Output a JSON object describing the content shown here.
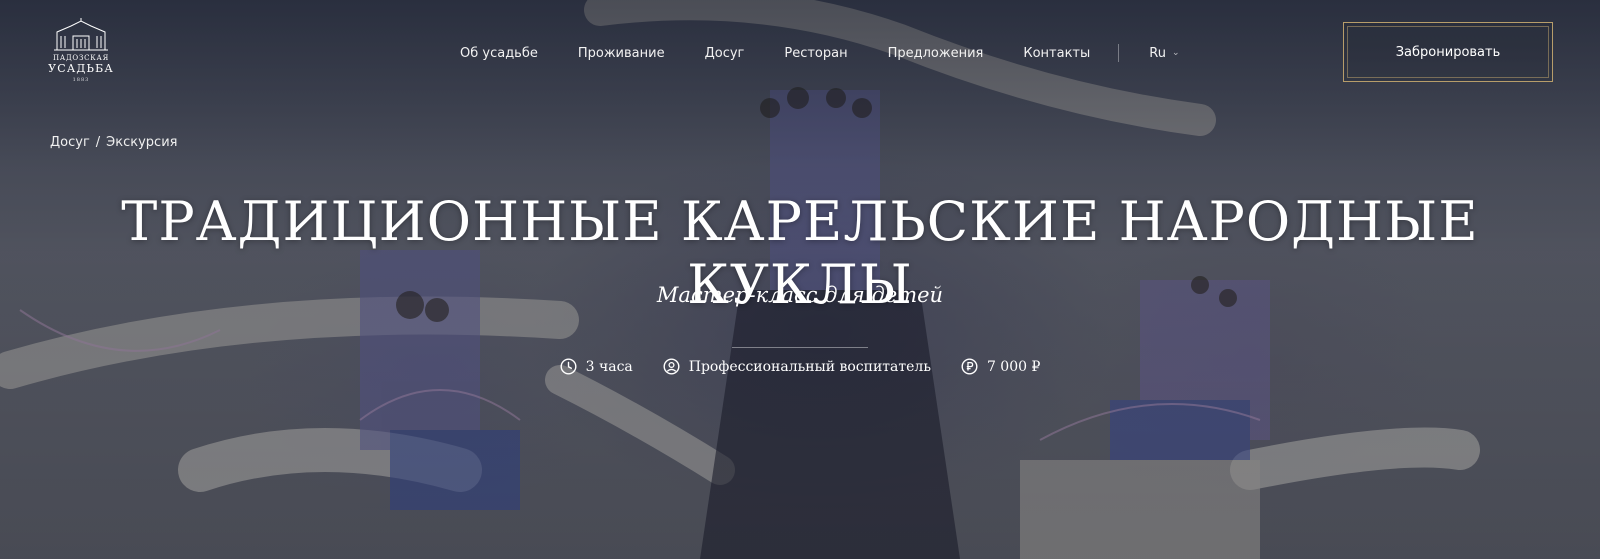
{
  "logo": {
    "line1": "ПАДОЗСКАЯ",
    "line2": "УСАДЬБА",
    "line3": "1883"
  },
  "nav": {
    "items": [
      "Об усадьбе",
      "Проживание",
      "Досуг",
      "Ресторан",
      "Предложения",
      "Контакты"
    ],
    "lang": "Ru"
  },
  "header": {
    "book_label": "Забронировать"
  },
  "breadcrumb": {
    "items": [
      "Досуг",
      "Экскурсия"
    ],
    "separator": "/"
  },
  "hero": {
    "title": "ТРАДИЦИОННЫЕ КАРЕЛЬСКИЕ НАРОДНЫЕ КУКЛЫ",
    "subtitle": "Мастер-класс для детей"
  },
  "meta": {
    "duration": "3 часа",
    "guide": "Профессиональный воспитатель",
    "price": "7 000 ₽"
  },
  "icons": {
    "duration": "clock-icon",
    "guide": "user-circle-icon",
    "price": "ruble-icon",
    "lang": "chevron-down-icon"
  },
  "colors": {
    "accent_gold": "#b79d6a",
    "overlay": "#1a2030"
  }
}
